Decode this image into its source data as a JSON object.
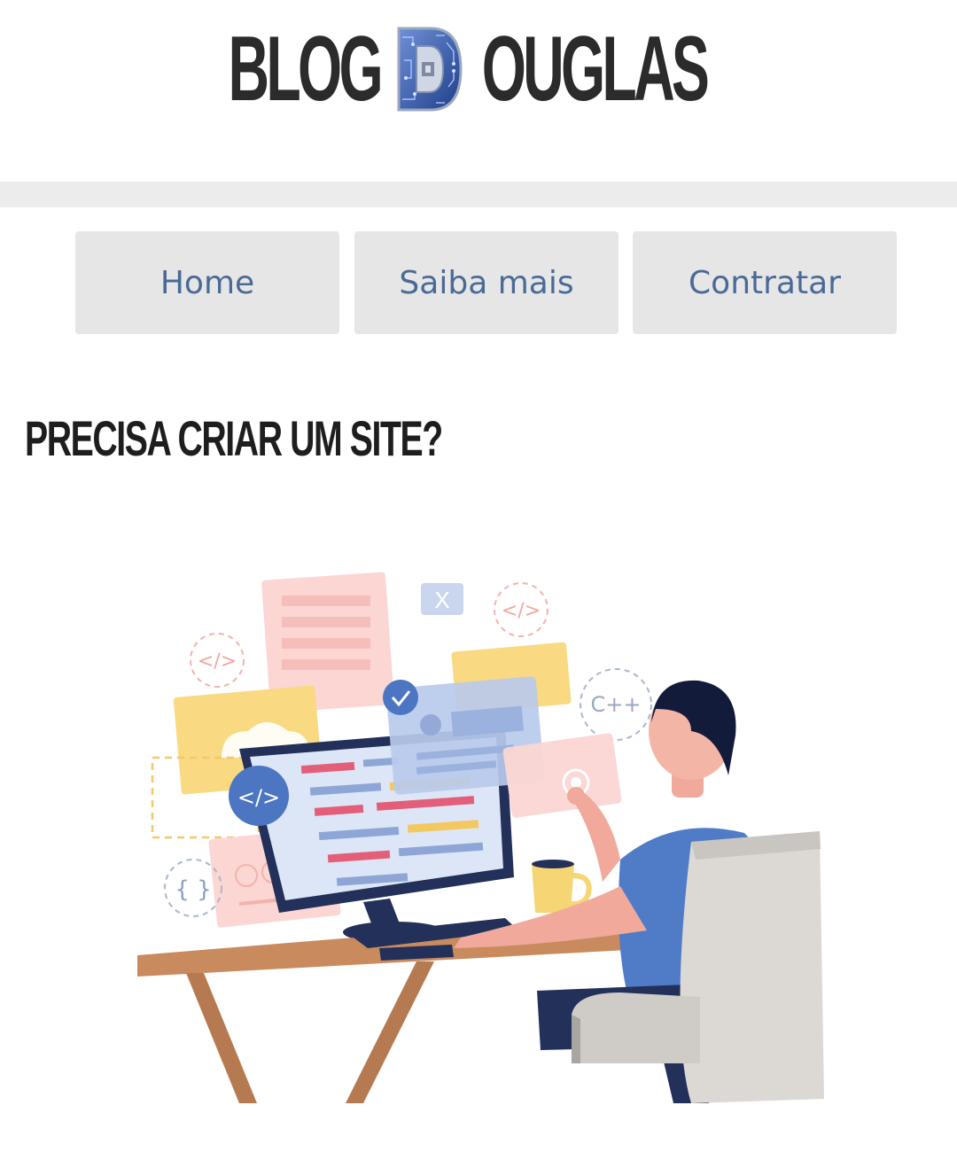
{
  "logo": {
    "part1": "BLOG",
    "letter": "D",
    "part2": "OUGLAS"
  },
  "nav": {
    "items": [
      {
        "label": "Home"
      },
      {
        "label": "Saiba mais"
      },
      {
        "label": "Contratar"
      }
    ]
  },
  "main": {
    "heading": "PRECISA CRIAR UM SITE?",
    "illustration": {
      "tags": {
        "code_left": "</>",
        "code_right": "</>",
        "code_badge": "</>",
        "cpp": "C++",
        "braces": "{ }",
        "close": "X"
      }
    }
  },
  "colors": {
    "nav_text": "#4a6a96",
    "nav_bg": "#e6e6e6",
    "heading": "#1e1e1e",
    "divider": "#ececec"
  }
}
